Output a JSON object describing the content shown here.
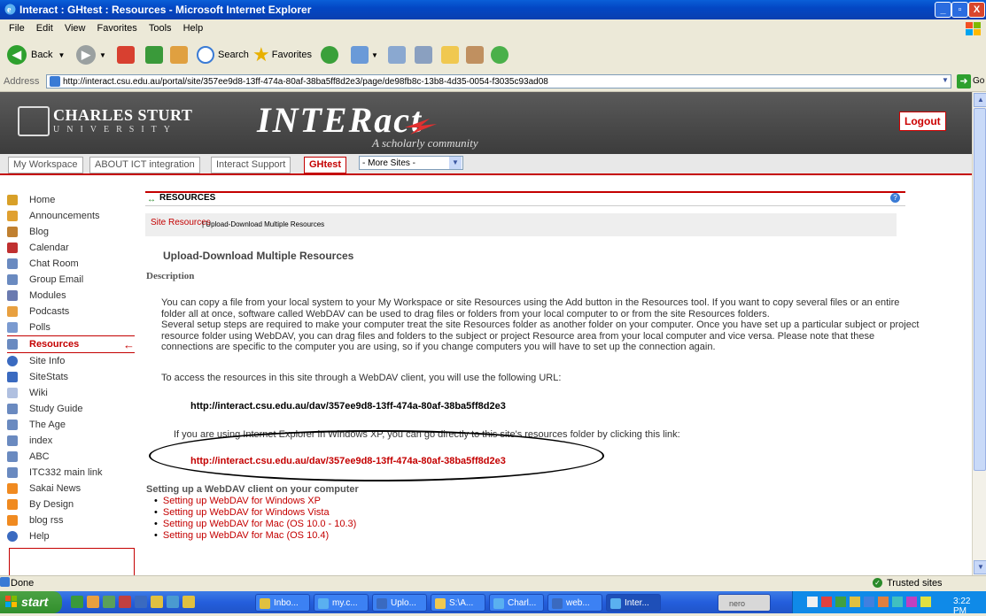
{
  "window": {
    "title": "Interact : GHtest : Resources - Microsoft Internet Explorer",
    "min": "_",
    "max": "▫",
    "close": "X"
  },
  "menu": [
    "File",
    "Edit",
    "View",
    "Favorites",
    "Tools",
    "Help"
  ],
  "toolbar": {
    "back": "Back",
    "search": "Search",
    "favorites": "Favorites"
  },
  "address": {
    "label": "Address",
    "url": "http://interact.csu.edu.au/portal/site/357ee9d8-13ff-474a-80af-38ba5ff8d2e3/page/de98fb8c-13b8-4d35-0054-f3035c93ad08",
    "go": "Go"
  },
  "header": {
    "university_name": "CHARLES STURT",
    "university_sub": "UNIVERSITY",
    "app_logo": "INTERact",
    "tagline": "A scholarly community",
    "logout": "Logout"
  },
  "sites": {
    "tabs": [
      "My Workspace",
      "ABOUT ICT integration",
      "Interact Support",
      "GHtest"
    ],
    "active": "GHtest",
    "more_sites": "- More Sites -"
  },
  "nav": {
    "items": [
      {
        "label": "Home",
        "icon": "home-icon",
        "color": "#d8a028"
      },
      {
        "label": "Announcements",
        "icon": "megaphone-icon",
        "color": "#e0a030"
      },
      {
        "label": "Blog",
        "icon": "pen-icon",
        "color": "#c08030"
      },
      {
        "label": "Calendar",
        "icon": "calendar-icon",
        "color": "#c03030"
      },
      {
        "label": "Chat Room",
        "icon": "chat-icon",
        "color": "#6a8ac0"
      },
      {
        "label": "Group Email",
        "icon": "email-icon",
        "color": "#6a8ac0"
      },
      {
        "label": "Modules",
        "icon": "modules-icon",
        "color": "#6a7ab0"
      },
      {
        "label": "Podcasts",
        "icon": "podcast-icon",
        "color": "#e8a040"
      },
      {
        "label": "Polls",
        "icon": "poll-icon",
        "color": "#7a9ad0"
      },
      {
        "label": "Resources",
        "icon": "folder-icon",
        "color": "#6a8ac0"
      },
      {
        "label": "Site Info",
        "icon": "info-icon",
        "color": "#3a6ac0"
      },
      {
        "label": "SiteStats",
        "icon": "stats-icon",
        "color": "#3a6ac0"
      },
      {
        "label": "Wiki",
        "icon": "wiki-icon",
        "color": "#b0c0e0"
      },
      {
        "label": "Study Guide",
        "icon": "link-icon",
        "color": "#6a8ac0"
      },
      {
        "label": "The Age",
        "icon": "link-icon",
        "color": "#6a8ac0"
      },
      {
        "label": "index",
        "icon": "link-icon",
        "color": "#6a8ac0"
      },
      {
        "label": "ABC",
        "icon": "link-icon",
        "color": "#6a8ac0"
      },
      {
        "label": "ITC332 main link",
        "icon": "link-icon",
        "color": "#6a8ac0"
      },
      {
        "label": "Sakai News",
        "icon": "rss-icon",
        "color": "#f08a20"
      },
      {
        "label": "By Design",
        "icon": "rss-icon",
        "color": "#f08a20"
      },
      {
        "label": "blog rss",
        "icon": "rss-icon",
        "color": "#f08a20"
      },
      {
        "label": "Help",
        "icon": "help-icon",
        "color": "#3a6ac0"
      }
    ],
    "active": "Resources",
    "active_arrow": "←"
  },
  "tool": {
    "title": "RESOURCES",
    "site_resources_link": "Site Resources",
    "separator_text": "| Upload-Download Multiple Resources",
    "page_heading": "Upload-Download Multiple Resources",
    "description_heading": "Description",
    "para1": "You can copy a file from your local system to your My Workspace or site Resources using the Add button in the Resources tool. If you want to copy several files or an entire folder all at once, software called WebDAV can be used to drag files or folders from your local computer to or from the site Resources folders.",
    "para2": "Several setup steps are required to make your computer treat the site Resources folder as another folder on your computer. Once you have set up a particular subject or project resource folder using WebDAV, you can drag files and folders to the subject or project Resource area from your local computer and vice versa. Please note that these connections are specific to the computer you are using, so if you change computers you will have to set up the connection again.",
    "access_text": "To access the resources in this site through a WebDAV client, you will use the following URL:",
    "webdav_url": "http://interact.csu.edu.au/dav/357ee9d8-13ff-474a-80af-38ba5ff8d2e3",
    "ie_text": "If you are using Internet Explorer in Windows XP, you can go directly to this site's resources folder by clicking this link:",
    "webdav_link": "http://interact.csu.edu.au/dav/357ee9d8-13ff-474a-80af-38ba5ff8d2e3",
    "setup_heading": "Setting up a WebDAV client on your computer",
    "setup_links": [
      "Setting up WebDAV for Windows XP",
      "Setting up WebDAV for Windows Vista",
      "Setting up WebDAV for Mac (OS 10.0 - 10.3)",
      "Setting up WebDAV for Mac (OS 10.4)"
    ]
  },
  "status": {
    "text": "Done",
    "zone": "Trusted sites"
  },
  "taskbar": {
    "start": "start",
    "tasks": [
      "Inbo...",
      "my.c...",
      "Uplo...",
      "S:\\A...",
      "Charl...",
      "web...",
      "Inter..."
    ],
    "active_task": "Inter...",
    "nero": "nero",
    "clock": "3:22 PM"
  }
}
